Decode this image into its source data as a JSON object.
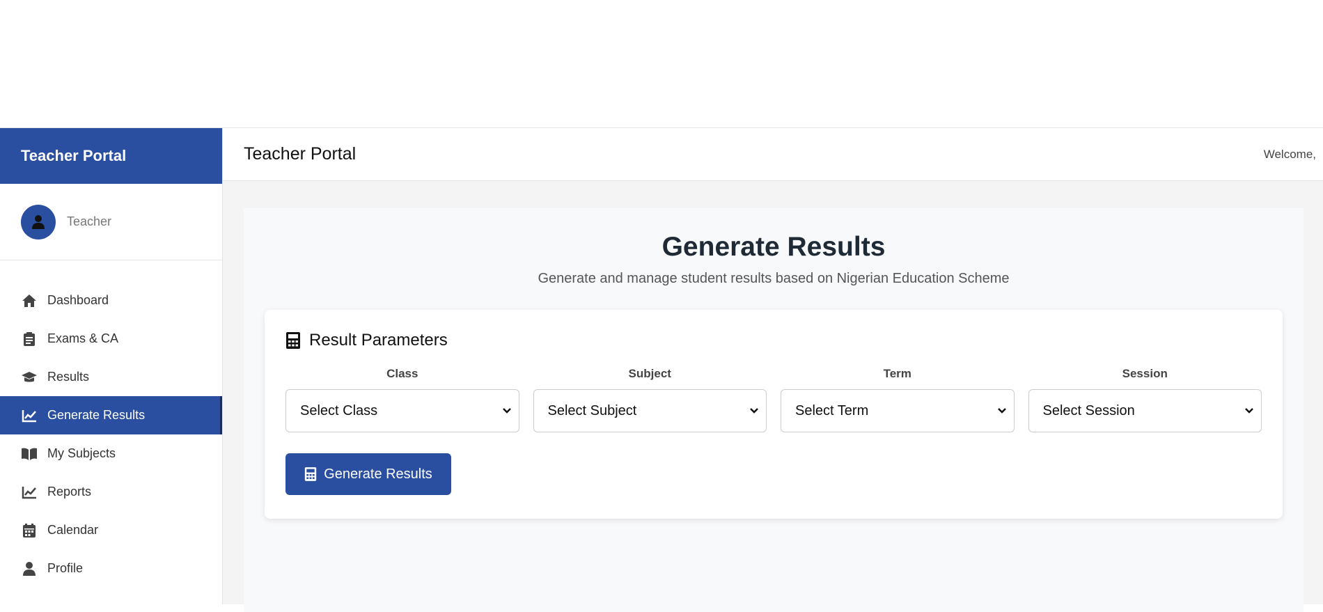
{
  "sidebar": {
    "brand": "Teacher Portal",
    "user_role": "Teacher",
    "items": [
      {
        "label": "Dashboard",
        "icon": "home-icon",
        "active": false
      },
      {
        "label": "Exams & CA",
        "icon": "clipboard-icon",
        "active": false
      },
      {
        "label": "Results",
        "icon": "graduation-cap-icon",
        "active": false
      },
      {
        "label": "Generate Results",
        "icon": "chart-line-icon",
        "active": true
      },
      {
        "label": "My Subjects",
        "icon": "book-icon",
        "active": false
      },
      {
        "label": "Reports",
        "icon": "chart-line-icon",
        "active": false
      },
      {
        "label": "Calendar",
        "icon": "calendar-icon",
        "active": false
      },
      {
        "label": "Profile",
        "icon": "user-icon",
        "active": false
      }
    ]
  },
  "header": {
    "title": "Teacher Portal",
    "welcome": "Welcome,"
  },
  "main": {
    "title": "Generate Results",
    "subtitle": "Generate and manage student results based on Nigerian Education Scheme",
    "card": {
      "title": "Result Parameters",
      "fields": [
        {
          "label": "Class",
          "value": "Select Class"
        },
        {
          "label": "Subject",
          "value": "Select Subject"
        },
        {
          "label": "Term",
          "value": "Select Term"
        },
        {
          "label": "Session",
          "value": "Select Session"
        }
      ],
      "button_label": "Generate Results"
    }
  },
  "colors": {
    "primary": "#2a4ea0",
    "page_bg": "#f4f4f4",
    "text_dark": "#1f2a37"
  }
}
